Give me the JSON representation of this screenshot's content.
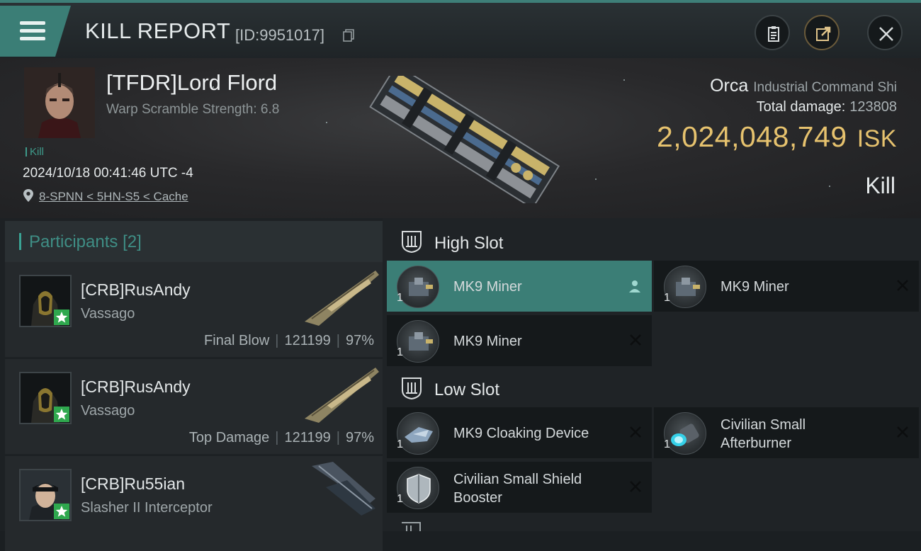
{
  "header": {
    "title": "KILL REPORT",
    "kill_id": "[ID:9951017]"
  },
  "victim": {
    "name": "[TFDR]Lord Flord",
    "subtitle": "Warp Scramble Strength: 6.8",
    "tag": "Kill",
    "datetime": "2024/10/18 00:41:46 UTC -4",
    "location": "8-SPNN < 5HN-S5 < Cache",
    "ship_name": "Orca",
    "ship_class": "Industrial Command Shi",
    "total_damage_label": "Total damage:",
    "total_damage_value": "123808",
    "isk_value": "2,024,048,749",
    "isk_unit": "ISK",
    "result": "Kill"
  },
  "participants": {
    "label": "Participants",
    "count": "[2]",
    "rows": [
      {
        "name": "[CRB]RusAndy",
        "ship": "Vassago",
        "role": "Final Blow",
        "damage": "121199",
        "percent": "97%"
      },
      {
        "name": "[CRB]RusAndy",
        "ship": "Vassago",
        "role": "Top Damage",
        "damage": "121199",
        "percent": "97%"
      },
      {
        "name": "[CRB]Ru55ian",
        "ship": "Slasher II Interceptor",
        "role": "",
        "damage": "",
        "percent": ""
      }
    ]
  },
  "slots": {
    "high": {
      "label": "High Slot",
      "items": [
        {
          "name": "MK9 Miner",
          "qty": "1"
        },
        {
          "name": "MK9 Miner",
          "qty": "1"
        },
        {
          "name": "MK9 Miner",
          "qty": "1"
        }
      ]
    },
    "low": {
      "label": "Low Slot",
      "items": [
        {
          "name": "MK9 Cloaking Device",
          "qty": "1"
        },
        {
          "name": "Civilian Small Afterburner",
          "qty": "1"
        },
        {
          "name": "Civilian Small Shield Booster",
          "qty": "1"
        }
      ]
    }
  },
  "colors": {
    "accent": "#3b7e76",
    "isk": "#e6c26e",
    "badge": "#2fa84e"
  },
  "icons": [
    "menu-icon",
    "copy-icon",
    "clipboard-icon",
    "share-icon",
    "close-icon",
    "location-pin-icon",
    "slot-icon",
    "person-icon",
    "remove-icon"
  ]
}
